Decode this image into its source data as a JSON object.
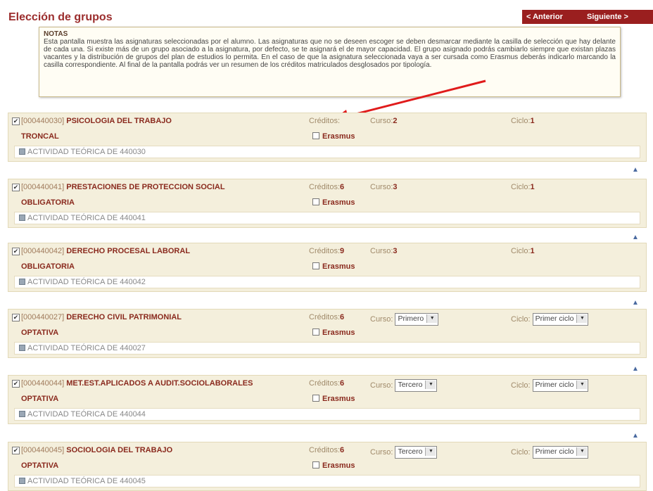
{
  "header": {
    "title": "Elección de grupos",
    "prev_label": "< Anterior",
    "next_label": "Siguiente >"
  },
  "notes": {
    "title": "NOTAS",
    "text": "Esta pantalla muestra las asignaturas seleccionadas por el alumno. Las asignaturas que no se deseen escoger se deben desmarcar mediante la casilla de selección que hay delante de cada una. Si existe más de un grupo asociado a la asignatura, por defecto, se te asignará el de mayor capacidad. El grupo asignado podrás cambiarlo siempre que existan plazas vacantes y la distribución de grupos del plan de estudios lo permita. En el caso de que la asignatura seleccionada vaya a ser cursada como Erasmus deberás indicarlo marcando la casilla correspondiente. Al final de la pantalla podrás ver un resumen de los créditos matriculados desglosados por tipología."
  },
  "labels": {
    "creditos": "Créditos:",
    "curso": "Curso:",
    "ciclo": "Ciclo:",
    "erasmus": "Erasmus",
    "check": "✔",
    "up": "▲",
    "dd": "▼"
  },
  "subjects": [
    {
      "code": "[000440030]",
      "name": "PSICOLOGIA DEL TRABAJO",
      "type": "TRONCAL",
      "creditos": "",
      "curso": "2",
      "ciclo": "1",
      "activity": "ACTIVIDAD TEÓRICA DE 440030"
    },
    {
      "code": "[000440041]",
      "name": "PRESTACIONES DE PROTECCION SOCIAL",
      "type": "OBLIGATORIA",
      "creditos": "6",
      "curso": "3",
      "ciclo": "1",
      "activity": "ACTIVIDAD TEÓRICA DE 440041"
    },
    {
      "code": "[000440042]",
      "name": "DERECHO PROCESAL LABORAL",
      "type": "OBLIGATORIA",
      "creditos": "9",
      "curso": "3",
      "ciclo": "1",
      "activity": "ACTIVIDAD TEÓRICA DE 440042"
    },
    {
      "code": "[000440027]",
      "name": "DERECHO CIVIL PATRIMONIAL",
      "type": "OPTATIVA",
      "creditos": "6",
      "curso_select": "Primero",
      "ciclo_select": "Primer ciclo",
      "activity": "ACTIVIDAD TEÓRICA DE 440027"
    },
    {
      "code": "[000440044]",
      "name": "MET.EST.APLICADOS A AUDIT.SOCIOLABORALES",
      "type": "OPTATIVA",
      "creditos": "6",
      "curso_select": "Tercero",
      "ciclo_select": "Primer ciclo",
      "activity": "ACTIVIDAD TEÓRICA DE 440044"
    },
    {
      "code": "[000440045]",
      "name": "SOCIOLOGIA DEL TRABAJO",
      "type": "OPTATIVA",
      "creditos": "6",
      "curso_select": "Tercero",
      "ciclo_select": "Primer ciclo",
      "activity": "ACTIVIDAD TEÓRICA DE 440045"
    }
  ]
}
